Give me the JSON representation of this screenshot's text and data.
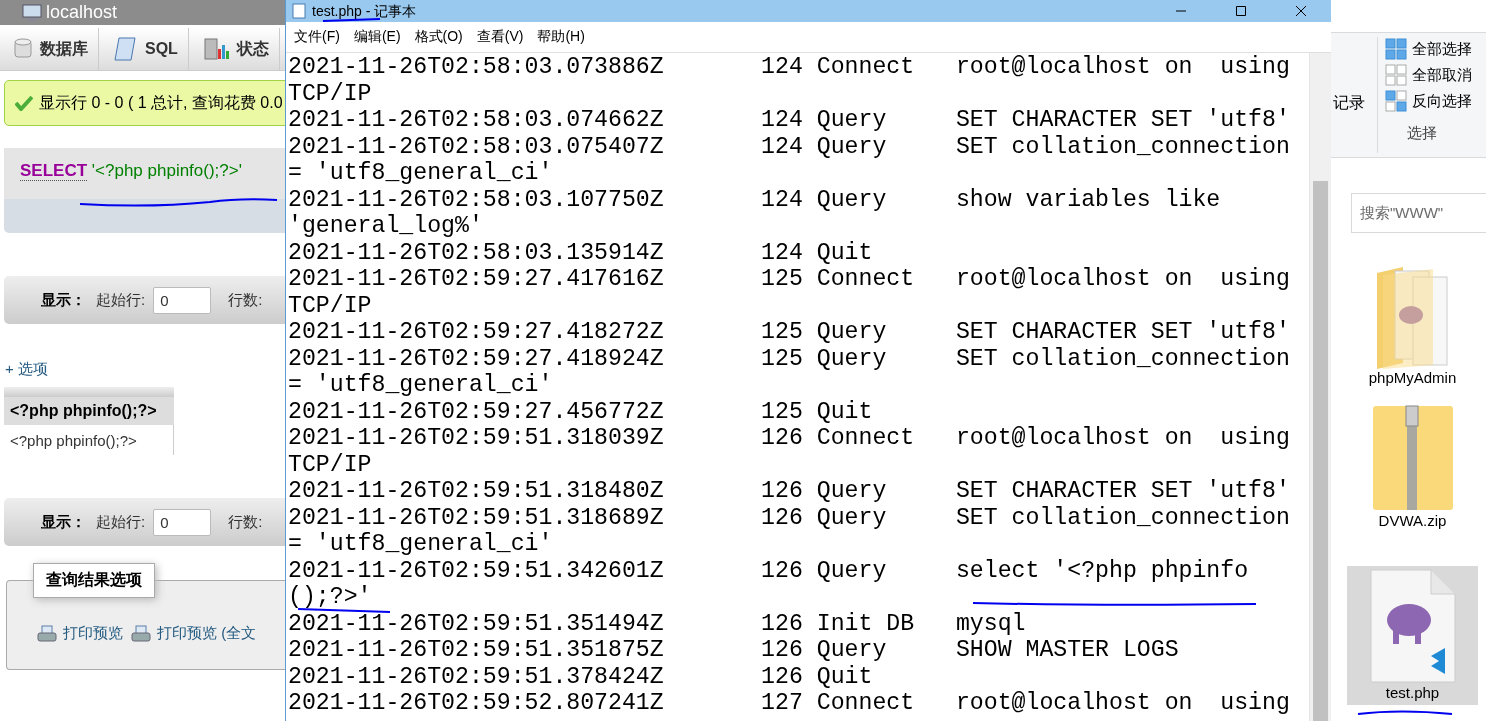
{
  "browser": {
    "title": "localhost",
    "tabs": [
      {
        "label": "数据库"
      },
      {
        "label": "SQL"
      },
      {
        "label": "状态"
      }
    ],
    "message": "显示行 0 - 0 ( 1 总计, 查询花费 0.0",
    "sql": {
      "keyword": "SELECT",
      "literal": "'<?php phpinfo();?>'"
    },
    "nav_bars": [
      {
        "label": "显示：",
        "start_label": "起始行:",
        "start_value": "0",
        "rows_label": "行数:"
      },
      {
        "label": "显示：",
        "start_label": "起始行:",
        "start_value": "0",
        "rows_label": "行数:"
      }
    ],
    "options_link": "+ 选项",
    "table": {
      "columns": [
        "<?php phpinfo();?>"
      ],
      "rows": [
        [
          "<?php phpinfo();?>"
        ]
      ]
    },
    "result_options": {
      "legend": "查询结果选项",
      "links": [
        "打印预览",
        "打印预览 (全文"
      ]
    }
  },
  "notepad": {
    "title": "test.php - 记事本",
    "menu": [
      "文件(F)",
      "编辑(E)",
      "格式(O)",
      "查看(V)",
      "帮助(H)"
    ],
    "lines": [
      "2021-11-26T02:58:03.073886Z       124 Connect   root@localhost on  using",
      "TCP/IP",
      "2021-11-26T02:58:03.074662Z       124 Query     SET CHARACTER SET 'utf8'",
      "2021-11-26T02:58:03.075407Z       124 Query     SET collation_connection",
      "= 'utf8_general_ci'",
      "2021-11-26T02:58:03.107750Z       124 Query     show variables like",
      "'general_log%'",
      "2021-11-26T02:58:03.135914Z       124 Quit",
      "2021-11-26T02:59:27.417616Z       125 Connect   root@localhost on  using",
      "TCP/IP",
      "2021-11-26T02:59:27.418272Z       125 Query     SET CHARACTER SET 'utf8'",
      "2021-11-26T02:59:27.418924Z       125 Query     SET collation_connection",
      "= 'utf8_general_ci'",
      "2021-11-26T02:59:27.456772Z       125 Quit",
      "2021-11-26T02:59:51.318039Z       126 Connect   root@localhost on  using",
      "TCP/IP",
      "2021-11-26T02:59:51.318480Z       126 Query     SET CHARACTER SET 'utf8'",
      "2021-11-26T02:59:51.318689Z       126 Query     SET collation_connection",
      "= 'utf8_general_ci'",
      "2021-11-26T02:59:51.342601Z       126 Query     select '<?php phpinfo",
      "();?>'",
      "2021-11-26T02:59:51.351494Z       126 Init DB   mysql",
      "2021-11-26T02:59:51.351875Z       126 Query     SHOW MASTER LOGS",
      "2021-11-26T02:59:51.378424Z       126 Quit",
      "2021-11-26T02:59:52.807241Z       127 Connect   root@localhost on  using"
    ]
  },
  "explorer": {
    "ribbon_items": [
      "记录"
    ],
    "select_group": {
      "commands": [
        "全部选择",
        "全部取消",
        "反向选择"
      ],
      "label": "选择"
    },
    "search": {
      "placeholder": "搜索\"WWW\""
    },
    "files": [
      {
        "name": "phpMyAdmin",
        "kind": "folder",
        "selected": false
      },
      {
        "name": "DVWA.zip",
        "kind": "zip",
        "selected": false
      },
      {
        "name": "test.php",
        "kind": "php",
        "selected": true
      }
    ]
  }
}
